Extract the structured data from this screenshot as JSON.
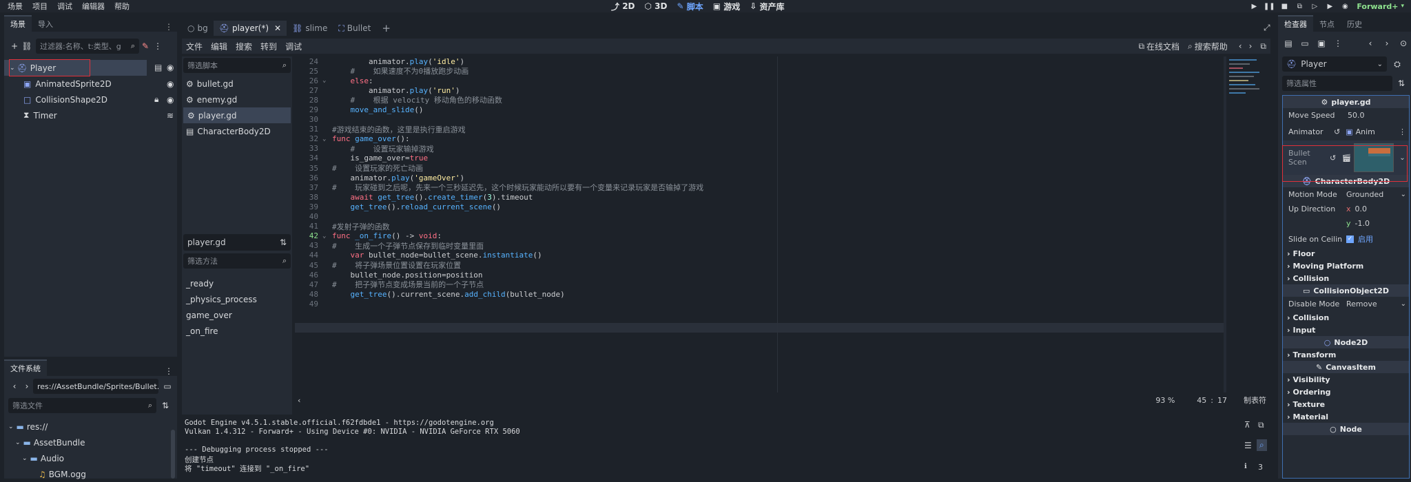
{
  "menu": [
    "场景",
    "项目",
    "调试",
    "编辑器",
    "帮助"
  ],
  "main_screens": {
    "d2": "2D",
    "d3": "3D",
    "script": "脚本",
    "game": "游戏",
    "assetlib": "资产库"
  },
  "renderer": "Forward+",
  "scene_dock": {
    "tabs": [
      "场景",
      "导入"
    ],
    "filter_placeholder": "过滤器:名称、t:类型、g",
    "nodes": [
      "Player",
      "AnimatedSprite2D",
      "CollisionShape2D",
      "Timer"
    ]
  },
  "filesystem": {
    "tab": "文件系统",
    "path": "res://AssetBundle/Sprites/Bullet.",
    "filter_placeholder": "筛选文件",
    "items": [
      "res://",
      "AssetBundle",
      "Audio",
      "BGM.ogg"
    ]
  },
  "editor_tabs": [
    "bg",
    "player(*)",
    "slime",
    "Bullet"
  ],
  "script_menu": [
    "文件",
    "编辑",
    "搜索",
    "转到",
    "调试"
  ],
  "online_docs": "在线文档",
  "search_help": "搜索帮助",
  "script_list": {
    "filter_placeholder": "筛选脚本",
    "scripts": [
      "bullet.gd",
      "enemy.gd",
      "player.gd",
      "CharacterBody2D"
    ],
    "current": "player.gd",
    "method_filter": "筛选方法",
    "methods": [
      "_ready",
      "_physics_process",
      "game_over",
      "_on_fire"
    ]
  },
  "code_lines": [
    {
      "n": "24",
      "fold": "",
      "t": [
        [
          "pl",
          "\t\t"
        ],
        [
          "pl",
          "animator."
        ],
        [
          "fn",
          "play"
        ],
        [
          "pl",
          "("
        ],
        [
          "str",
          "'idle'"
        ],
        [
          "pl",
          ")"
        ]
      ]
    },
    {
      "n": "25",
      "fold": "",
      "t": [
        [
          "cm",
          "\t#\t如果速度不为0播放跑步动画"
        ]
      ]
    },
    {
      "n": "26",
      "fold": "v",
      "t": [
        [
          "pl",
          "\t"
        ],
        [
          "kw",
          "else"
        ],
        [
          "pl",
          ":"
        ]
      ]
    },
    {
      "n": "27",
      "fold": "",
      "t": [
        [
          "pl",
          "\t\t"
        ],
        [
          "pl",
          "animator."
        ],
        [
          "fn",
          "play"
        ],
        [
          "pl",
          "("
        ],
        [
          "str",
          "'run'"
        ],
        [
          "pl",
          ")"
        ]
      ]
    },
    {
      "n": "28",
      "fold": "",
      "t": [
        [
          "cm",
          "\t#\t根据 velocity 移动角色的移动函数"
        ]
      ]
    },
    {
      "n": "29",
      "fold": "",
      "t": [
        [
          "pl",
          "\t"
        ],
        [
          "fn",
          "move_and_slide"
        ],
        [
          "pl",
          "()"
        ]
      ]
    },
    {
      "n": "30",
      "fold": "",
      "t": []
    },
    {
      "n": "31",
      "fold": "",
      "t": [
        [
          "cm",
          "#游戏结束的函数，这里是执行重启游戏"
        ]
      ]
    },
    {
      "n": "32",
      "fold": "v",
      "t": [
        [
          "kw",
          "func "
        ],
        [
          "fn",
          "game_over"
        ],
        [
          "pl",
          "():"
        ]
      ]
    },
    {
      "n": "33",
      "fold": "",
      "t": [
        [
          "cm",
          "\t#\t设置玩家输掉游戏"
        ]
      ]
    },
    {
      "n": "34",
      "fold": "",
      "t": [
        [
          "pl",
          "\tis_game_over="
        ],
        [
          "kw",
          "true"
        ]
      ]
    },
    {
      "n": "35",
      "fold": "",
      "t": [
        [
          "cm",
          "#\t设置玩家的死亡动画"
        ]
      ]
    },
    {
      "n": "36",
      "fold": "",
      "t": [
        [
          "pl",
          "\tanimator."
        ],
        [
          "fn",
          "play"
        ],
        [
          "pl",
          "("
        ],
        [
          "str",
          "'gameOver'"
        ],
        [
          "pl",
          ")"
        ]
      ]
    },
    {
      "n": "37",
      "fold": "",
      "t": [
        [
          "cm",
          "#\t玩家碰到之后呢，先来一个三秒延迟先，这个时候玩家能动所以要有一个变量来记录玩家是否输掉了游戏"
        ]
      ]
    },
    {
      "n": "38",
      "fold": "",
      "t": [
        [
          "kw",
          "\tawait "
        ],
        [
          "fn",
          "get_tree"
        ],
        [
          "pl",
          "()."
        ],
        [
          "fn",
          "create_timer"
        ],
        [
          "pl",
          "("
        ],
        [
          "num2",
          "3"
        ],
        [
          "pl",
          ").timeout"
        ]
      ]
    },
    {
      "n": "39",
      "fold": "",
      "t": [
        [
          "pl",
          "\t"
        ],
        [
          "fn",
          "get_tree"
        ],
        [
          "pl",
          "()."
        ],
        [
          "fn",
          "reload_current_scene"
        ],
        [
          "pl",
          "()"
        ]
      ]
    },
    {
      "n": "40",
      "fold": "",
      "t": []
    },
    {
      "n": "41",
      "fold": "",
      "t": [
        [
          "cm",
          "#发射子弹的函数"
        ]
      ]
    },
    {
      "n": "42",
      "fold": "v",
      "t": [
        [
          "kw",
          "func "
        ],
        [
          "fn",
          "_on_fire"
        ],
        [
          "pl",
          "() -> "
        ],
        [
          "kw",
          "void"
        ],
        [
          "pl",
          ":"
        ]
      ]
    },
    {
      "n": "43",
      "fold": "",
      "t": [
        [
          "cm",
          "#\t生成一个子弹节点保存到临时变量里面"
        ]
      ]
    },
    {
      "n": "44",
      "fold": "",
      "t": [
        [
          "kw",
          "\tvar "
        ],
        [
          "pl",
          "bullet_node=bullet_scene."
        ],
        [
          "fn",
          "instantiate"
        ],
        [
          "pl",
          "()"
        ]
      ]
    },
    {
      "n": "45",
      "fold": "",
      "t": [
        [
          "cm",
          "#\t将子弹场景位置设置在玩家位置"
        ]
      ]
    },
    {
      "n": "46",
      "fold": "",
      "t": [
        [
          "pl",
          "\tbullet_node.position=position"
        ]
      ]
    },
    {
      "n": "47",
      "fold": "",
      "t": [
        [
          "cm",
          "#\t把子弹节点变成场景当前的一个子节点"
        ]
      ]
    },
    {
      "n": "48",
      "fold": "",
      "t": [
        [
          "pl",
          "\t"
        ],
        [
          "fn",
          "get_tree"
        ],
        [
          "pl",
          "().current_scene."
        ],
        [
          "fn",
          "add_child"
        ],
        [
          "pl",
          "(bullet_node)"
        ]
      ]
    },
    {
      "n": "49",
      "fold": "",
      "t": []
    }
  ],
  "status": {
    "zoom": "93 %",
    "line": "45",
    "col": "17",
    "indent": "制表符"
  },
  "output": [
    "Godot Engine v4.5.1.stable.official.f62fdbde1 - https://godotengine.org",
    "Vulkan 1.4.312 - Forward+ - Using Device #0: NVIDIA - NVIDIA GeForce RTX 5060",
    "",
    "--- Debugging process stopped ---",
    "创建节点",
    "将 \"timeout\" 连接到 \"_on_fire\""
  ],
  "output_count": "3",
  "inspector": {
    "tabs": [
      "检查器",
      "节点",
      "历史"
    ],
    "object": "Player",
    "filter_placeholder": "筛选属性",
    "script_name": "player.gd",
    "move_speed_label": "Move Speed",
    "move_speed": "50.0",
    "animator_label": "Animator",
    "animator_value": "Anim",
    "bullet_label": "Bullet Scen",
    "class1": "CharacterBody2D",
    "motion_mode_label": "Motion Mode",
    "motion_mode": "Grounded",
    "up_dir_label": "Up Direction",
    "up_x": "0.0",
    "up_y": "-1.0",
    "slide_label": "Slide on Ceilin",
    "slide_value": "启用",
    "groups1": [
      "Floor",
      "Moving Platform",
      "Collision"
    ],
    "class2": "CollisionObject2D",
    "disable_mode_label": "Disable Mode",
    "disable_mode": "Remove",
    "groups2": [
      "Collision",
      "Input"
    ],
    "class3": "Node2D",
    "groups3": [
      "Transform"
    ],
    "class4": "CanvasItem",
    "groups4": [
      "Visibility",
      "Ordering",
      "Texture",
      "Material"
    ],
    "class5": "Node"
  },
  "colors": {
    "accent": "#6fa6ff",
    "highlight_box": "#e0303a",
    "bg": "#1d2229",
    "panel": "#252b34"
  }
}
